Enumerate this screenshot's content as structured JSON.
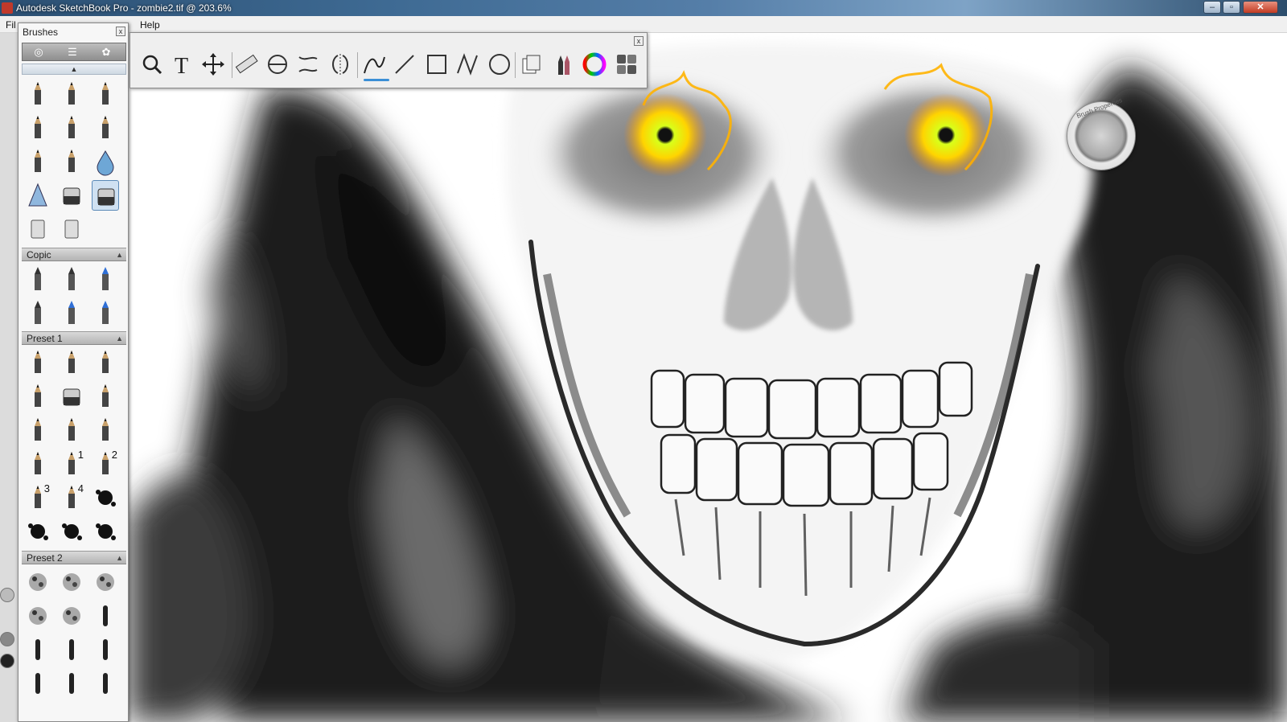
{
  "window": {
    "title": "Autodesk SketchBook Pro - zombie2.tif @ 203.6%",
    "minimize_label": "–",
    "maximize_label": "▫",
    "close_label": "✕"
  },
  "menu": {
    "file_label": "Fil",
    "help_label": "Help"
  },
  "brushes_panel": {
    "title": "Brushes",
    "close_label": "x",
    "tabs": [
      "brush-library-icon",
      "brush-settings-icon",
      "brush-options-icon"
    ],
    "selected_brush": "eraser-hard",
    "default_brushes": [
      "pencil",
      "ink-pen",
      "marker",
      "felt-pen",
      "ballpoint",
      "paintbrush",
      "fine-pen",
      "airbrush",
      "water-drop",
      "smudge",
      "eraser-soft",
      "eraser-hard",
      "fill-bucket",
      "fill-stack"
    ],
    "sections": [
      {
        "name": "Copic",
        "brushes": [
          "copic-1",
          "copic-2",
          "copic-3",
          "copic-4",
          "copic-5",
          "copic-6"
        ]
      },
      {
        "name": "Preset 1",
        "brushes": [
          "p1-pencil",
          "p1-flat",
          "p1-pen",
          "p1-marker",
          "p1-eraser",
          "p1-chisel",
          "p1-flat-2",
          "p1-round",
          "p1-bottle",
          "p1-dropper",
          "p1-nib-1",
          "p1-nib-2",
          "p1-nib-3",
          "p1-nib-4",
          "p1-splatter",
          "p1-blob",
          "p1-splat-2",
          "p1-splat-3"
        ],
        "nib_numbers": [
          "1",
          "2",
          "3",
          "4"
        ]
      },
      {
        "name": "Preset 2",
        "brushes": [
          "texture-1",
          "texture-2",
          "texture-3",
          "dots",
          "speckle",
          "stick-1",
          "stick-2",
          "stick-3",
          "stick-4",
          "line-1",
          "line-2",
          "line-3"
        ]
      }
    ]
  },
  "toolbar": {
    "close_label": "x",
    "tools": [
      "zoom-icon",
      "text-icon",
      "move-icon",
      "ruler-icon",
      "ellipse-guide-icon",
      "french-curve-icon",
      "symmetry-icon",
      "freehand-stroke-icon",
      "line-icon",
      "rectangle-icon",
      "polyline-icon",
      "ellipse-icon",
      "layers-icon",
      "brush-palette-icon",
      "color-wheel-icon",
      "swatches-icon"
    ],
    "active_tool": "freehand-stroke-icon"
  },
  "puck": {
    "label": "Brush Properties"
  },
  "colors": {
    "eye_fire": "#ffcc00",
    "eye_core": "#c8ff00",
    "accent": "#3b8fd6"
  }
}
